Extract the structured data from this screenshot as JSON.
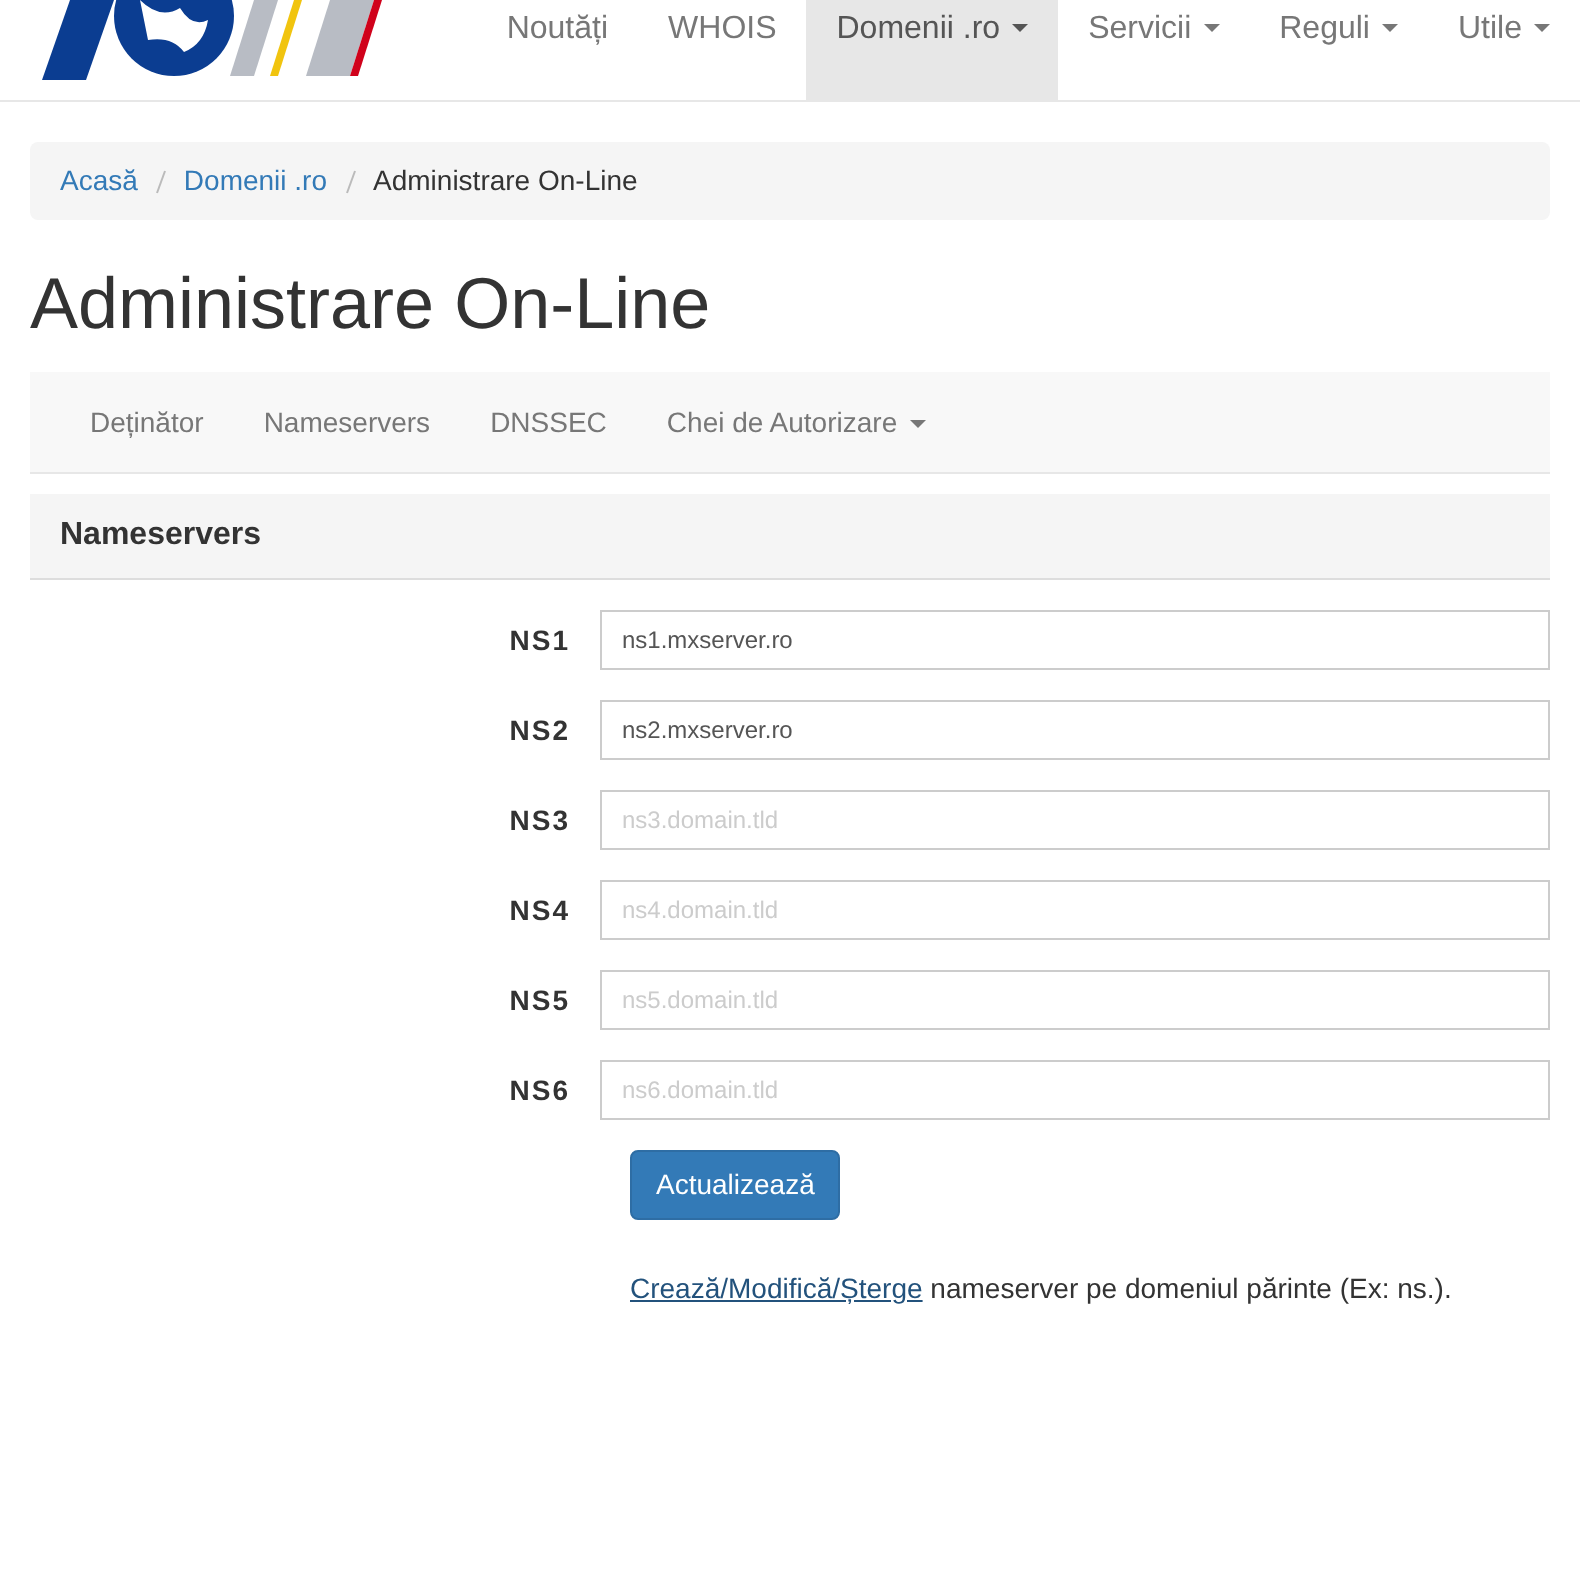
{
  "navbar": {
    "items": [
      {
        "label": "Noutăți",
        "dropdown": false,
        "selected": false
      },
      {
        "label": "WHOIS",
        "dropdown": false,
        "selected": false
      },
      {
        "label": "Domenii .ro",
        "dropdown": true,
        "selected": true
      },
      {
        "label": "Servicii",
        "dropdown": true,
        "selected": false
      },
      {
        "label": "Reguli",
        "dropdown": true,
        "selected": false
      },
      {
        "label": "Utile",
        "dropdown": true,
        "selected": false
      }
    ]
  },
  "breadcrumb": [
    {
      "label": "Acasă",
      "active": false
    },
    {
      "label": "Domenii .ro",
      "active": false
    },
    {
      "label": "Administrare On-Line",
      "active": true
    }
  ],
  "title": "Administrare On-Line",
  "subnav": [
    {
      "label": "Deținător",
      "dropdown": false
    },
    {
      "label": "Nameservers",
      "dropdown": false
    },
    {
      "label": "DNSSEC",
      "dropdown": false
    },
    {
      "label": "Chei de Autorizare",
      "dropdown": true
    }
  ],
  "panel": {
    "title": "Nameservers",
    "fields": [
      {
        "label": "NS1",
        "value": "ns1.mxserver.ro"
      },
      {
        "label": "NS2",
        "value": "ns2.mxserver.ro"
      },
      {
        "label": "NS3",
        "placeholder": "ns3.domain.tld"
      },
      {
        "label": "NS4",
        "placeholder": "ns4.domain.tld"
      },
      {
        "label": "NS5",
        "placeholder": "ns5.domain.tld"
      },
      {
        "label": "NS6",
        "placeholder": "ns6.domain.tld"
      }
    ],
    "button": "Actualizează",
    "note": {
      "link": "Crează/Modifică/Șterge",
      "text": "nameserver pe domeniul părinte (Ex: ns.)."
    }
  }
}
